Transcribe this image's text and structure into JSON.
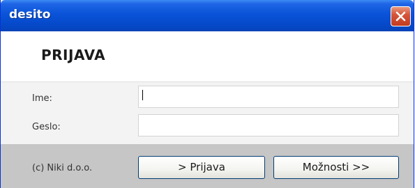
{
  "window": {
    "title": "desito",
    "close_icon": "close-icon",
    "title_color": "#0a53d8",
    "close_color": "#c23c20"
  },
  "header": {
    "title": "PRIJAVA"
  },
  "form": {
    "username_label": "Ime:",
    "username_value": "",
    "password_label": "Geslo:",
    "password_value": ""
  },
  "footer": {
    "copyright": "(c) Niki d.o.o.",
    "login_button": "> Prijava",
    "options_button": "Možnosti >>"
  }
}
